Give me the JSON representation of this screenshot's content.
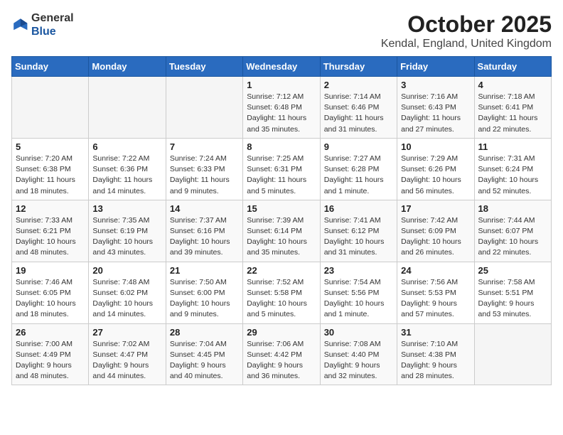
{
  "header": {
    "logo": {
      "general": "General",
      "blue": "Blue"
    },
    "title": "October 2025",
    "location": "Kendal, England, United Kingdom"
  },
  "weekdays": [
    "Sunday",
    "Monday",
    "Tuesday",
    "Wednesday",
    "Thursday",
    "Friday",
    "Saturday"
  ],
  "weeks": [
    [
      {
        "day": "",
        "info": ""
      },
      {
        "day": "",
        "info": ""
      },
      {
        "day": "",
        "info": ""
      },
      {
        "day": "1",
        "info": "Sunrise: 7:12 AM\nSunset: 6:48 PM\nDaylight: 11 hours and 35 minutes."
      },
      {
        "day": "2",
        "info": "Sunrise: 7:14 AM\nSunset: 6:46 PM\nDaylight: 11 hours and 31 minutes."
      },
      {
        "day": "3",
        "info": "Sunrise: 7:16 AM\nSunset: 6:43 PM\nDaylight: 11 hours and 27 minutes."
      },
      {
        "day": "4",
        "info": "Sunrise: 7:18 AM\nSunset: 6:41 PM\nDaylight: 11 hours and 22 minutes."
      }
    ],
    [
      {
        "day": "5",
        "info": "Sunrise: 7:20 AM\nSunset: 6:38 PM\nDaylight: 11 hours and 18 minutes."
      },
      {
        "day": "6",
        "info": "Sunrise: 7:22 AM\nSunset: 6:36 PM\nDaylight: 11 hours and 14 minutes."
      },
      {
        "day": "7",
        "info": "Sunrise: 7:24 AM\nSunset: 6:33 PM\nDaylight: 11 hours and 9 minutes."
      },
      {
        "day": "8",
        "info": "Sunrise: 7:25 AM\nSunset: 6:31 PM\nDaylight: 11 hours and 5 minutes."
      },
      {
        "day": "9",
        "info": "Sunrise: 7:27 AM\nSunset: 6:28 PM\nDaylight: 11 hours and 1 minute."
      },
      {
        "day": "10",
        "info": "Sunrise: 7:29 AM\nSunset: 6:26 PM\nDaylight: 10 hours and 56 minutes."
      },
      {
        "day": "11",
        "info": "Sunrise: 7:31 AM\nSunset: 6:24 PM\nDaylight: 10 hours and 52 minutes."
      }
    ],
    [
      {
        "day": "12",
        "info": "Sunrise: 7:33 AM\nSunset: 6:21 PM\nDaylight: 10 hours and 48 minutes."
      },
      {
        "day": "13",
        "info": "Sunrise: 7:35 AM\nSunset: 6:19 PM\nDaylight: 10 hours and 43 minutes."
      },
      {
        "day": "14",
        "info": "Sunrise: 7:37 AM\nSunset: 6:16 PM\nDaylight: 10 hours and 39 minutes."
      },
      {
        "day": "15",
        "info": "Sunrise: 7:39 AM\nSunset: 6:14 PM\nDaylight: 10 hours and 35 minutes."
      },
      {
        "day": "16",
        "info": "Sunrise: 7:41 AM\nSunset: 6:12 PM\nDaylight: 10 hours and 31 minutes."
      },
      {
        "day": "17",
        "info": "Sunrise: 7:42 AM\nSunset: 6:09 PM\nDaylight: 10 hours and 26 minutes."
      },
      {
        "day": "18",
        "info": "Sunrise: 7:44 AM\nSunset: 6:07 PM\nDaylight: 10 hours and 22 minutes."
      }
    ],
    [
      {
        "day": "19",
        "info": "Sunrise: 7:46 AM\nSunset: 6:05 PM\nDaylight: 10 hours and 18 minutes."
      },
      {
        "day": "20",
        "info": "Sunrise: 7:48 AM\nSunset: 6:02 PM\nDaylight: 10 hours and 14 minutes."
      },
      {
        "day": "21",
        "info": "Sunrise: 7:50 AM\nSunset: 6:00 PM\nDaylight: 10 hours and 9 minutes."
      },
      {
        "day": "22",
        "info": "Sunrise: 7:52 AM\nSunset: 5:58 PM\nDaylight: 10 hours and 5 minutes."
      },
      {
        "day": "23",
        "info": "Sunrise: 7:54 AM\nSunset: 5:56 PM\nDaylight: 10 hours and 1 minute."
      },
      {
        "day": "24",
        "info": "Sunrise: 7:56 AM\nSunset: 5:53 PM\nDaylight: 9 hours and 57 minutes."
      },
      {
        "day": "25",
        "info": "Sunrise: 7:58 AM\nSunset: 5:51 PM\nDaylight: 9 hours and 53 minutes."
      }
    ],
    [
      {
        "day": "26",
        "info": "Sunrise: 7:00 AM\nSunset: 4:49 PM\nDaylight: 9 hours and 48 minutes."
      },
      {
        "day": "27",
        "info": "Sunrise: 7:02 AM\nSunset: 4:47 PM\nDaylight: 9 hours and 44 minutes."
      },
      {
        "day": "28",
        "info": "Sunrise: 7:04 AM\nSunset: 4:45 PM\nDaylight: 9 hours and 40 minutes."
      },
      {
        "day": "29",
        "info": "Sunrise: 7:06 AM\nSunset: 4:42 PM\nDaylight: 9 hours and 36 minutes."
      },
      {
        "day": "30",
        "info": "Sunrise: 7:08 AM\nSunset: 4:40 PM\nDaylight: 9 hours and 32 minutes."
      },
      {
        "day": "31",
        "info": "Sunrise: 7:10 AM\nSunset: 4:38 PM\nDaylight: 9 hours and 28 minutes."
      },
      {
        "day": "",
        "info": ""
      }
    ]
  ]
}
